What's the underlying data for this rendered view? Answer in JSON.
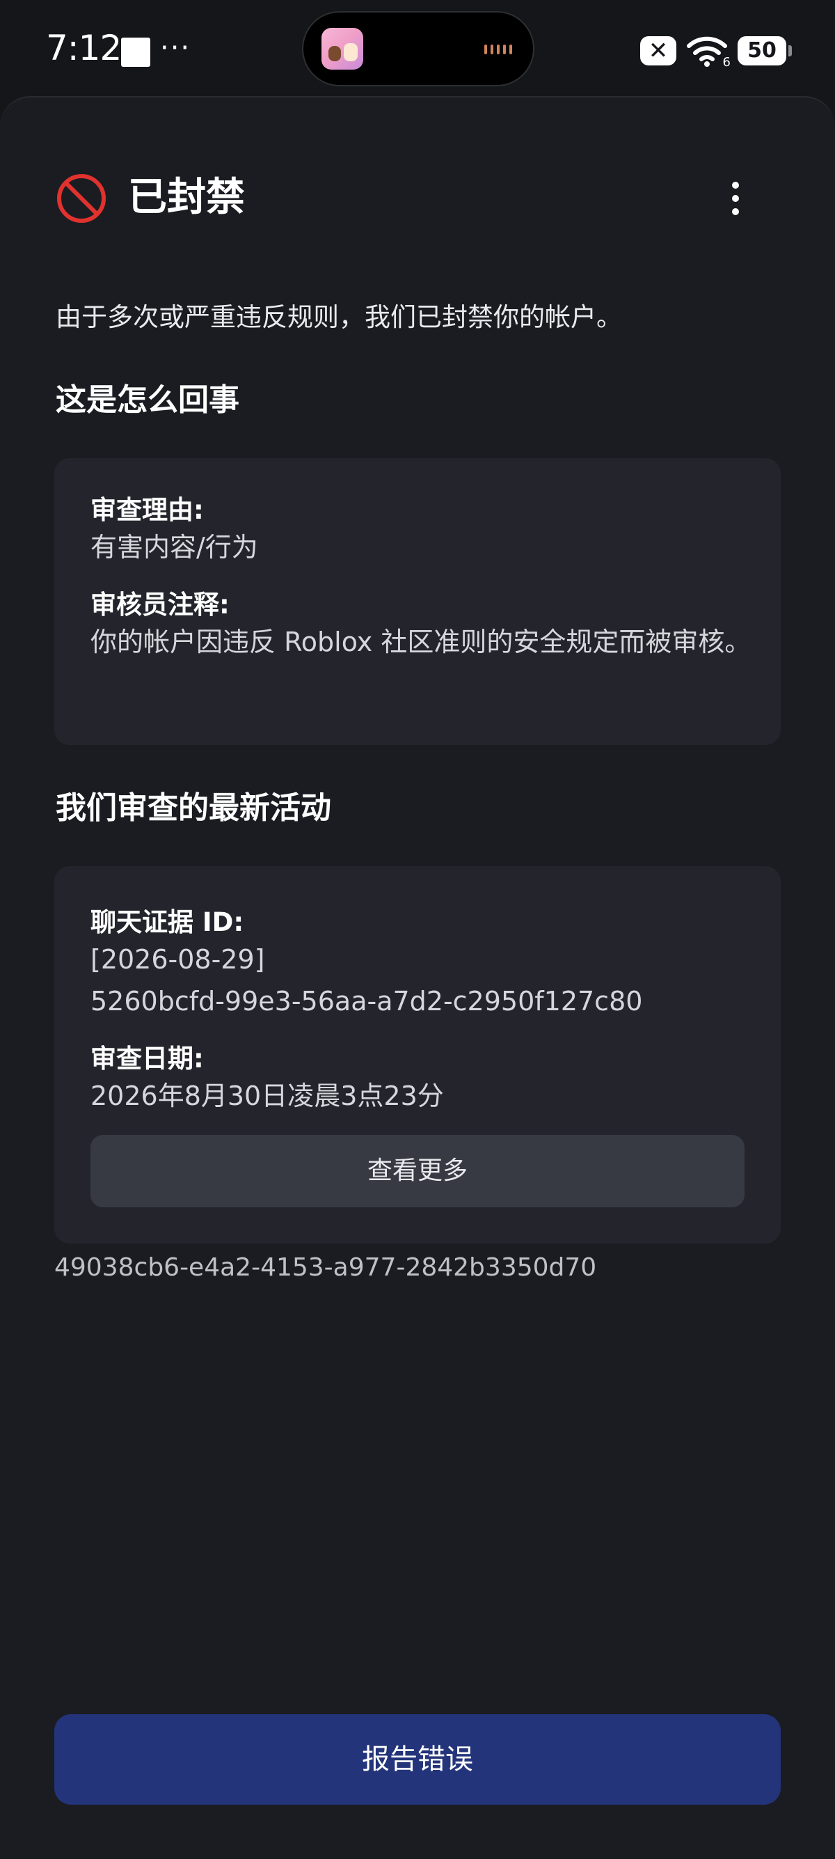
{
  "status_bar": {
    "time": "7:12",
    "more_indicator": "···",
    "close_badge": "✕",
    "wifi_sub": "6",
    "battery": "50",
    "icons": [
      "notification-square-icon",
      "album-art-icon",
      "audio-wave-icon",
      "close-badge-icon",
      "wifi-icon",
      "battery-icon"
    ]
  },
  "header": {
    "icon": "ban-icon",
    "title": "已封禁",
    "menu_icon": "more-vertical-icon"
  },
  "description": "由于多次或严重违反规则，我们已封禁你的帐户。",
  "section_what_happened": {
    "heading": "这是怎么回事",
    "reason_label": "审查理由:",
    "reason_value": "有害内容/行为",
    "note_label": "审核员注释:",
    "note_value": "你的帐户因违反 Roblox 社区准则的安全规定而被审核。"
  },
  "section_activity": {
    "heading": "我们审查的最新活动",
    "evidence_label": "聊天证据 ID:",
    "evidence_date": "[2026-08-29]",
    "evidence_id": "5260bcfd-99e3-56aa-a7d2-c2950f127c80",
    "review_date_label": "审查日期:",
    "review_date_value": "2026年8月30日凌晨3点23分",
    "view_more_label": "查看更多"
  },
  "trace_id": "49038cb6-e4a2-4153-a977-2842b3350d70",
  "report_button_label": "报告错误",
  "colors": {
    "background": "#1b1c21",
    "card": "#24252c",
    "ban_red": "#e0322e",
    "report_button": "#23347a",
    "view_more_button": "#383a43"
  }
}
